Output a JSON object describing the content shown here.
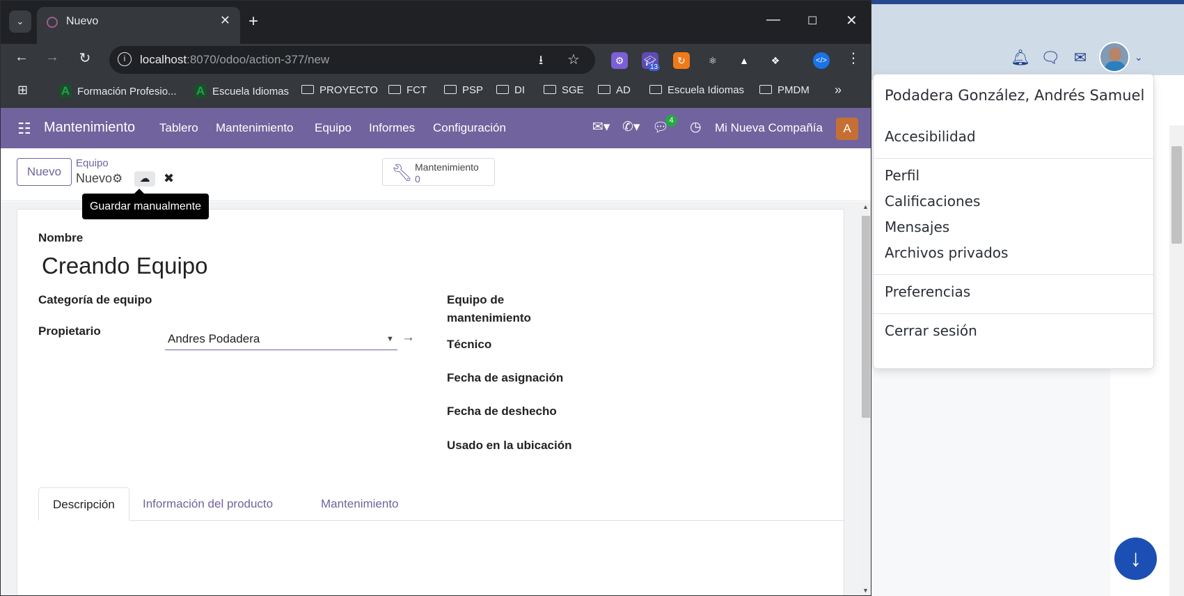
{
  "browser": {
    "tab_title": "Nuevo",
    "url_host": "localhost",
    "url_rest": ":8070/odoo/action-377/new",
    "bookmarks": [
      "Formación Profesio...",
      "Escuela Idiomas",
      "PROYECTO",
      "FCT",
      "PSP",
      "DI",
      "SGE",
      "AD",
      "Escuela Idiomas",
      "PMDM"
    ],
    "extension_badge": "13"
  },
  "odoo_nav": {
    "app_name": "Mantenimiento",
    "menu": [
      "Tablero",
      "Mantenimiento",
      "Equipo",
      "Informes",
      "Configuración"
    ],
    "chat_badge": "4",
    "company": "Mi Nueva Compañía",
    "avatar_letter": "A",
    "brand_color": "#71639e"
  },
  "control_panel": {
    "new_button": "Nuevo",
    "breadcrumb_parent": "Equipo",
    "breadcrumb_current": "Nuevo",
    "tooltip": "Guardar manualmente",
    "smart_button_label": "Mantenimiento",
    "smart_button_count": "0"
  },
  "form": {
    "name_label": "Nombre",
    "name_value": "Creando Equipo",
    "category_label": "Categoría de equipo",
    "owner_label": "Propietario",
    "owner_value": "Andres Podadera",
    "team_label_1": "Equipo de",
    "team_label_2": "mantenimiento",
    "technician_label": "Técnico",
    "assign_date_label": "Fecha de asignación",
    "scrap_date_label": "Fecha de deshecho",
    "location_label": "Usado en la ubicación",
    "tabs": [
      "Descripción",
      "Información del producto",
      "Mantenimiento"
    ]
  },
  "user_menu": {
    "user_name": "Podadera González, Andrés Samuel",
    "items": [
      "Accesibilidad",
      "Perfil",
      "Calificaciones",
      "Mensajes",
      "Archivos privados",
      "Preferencias",
      "Cerrar sesión"
    ]
  }
}
